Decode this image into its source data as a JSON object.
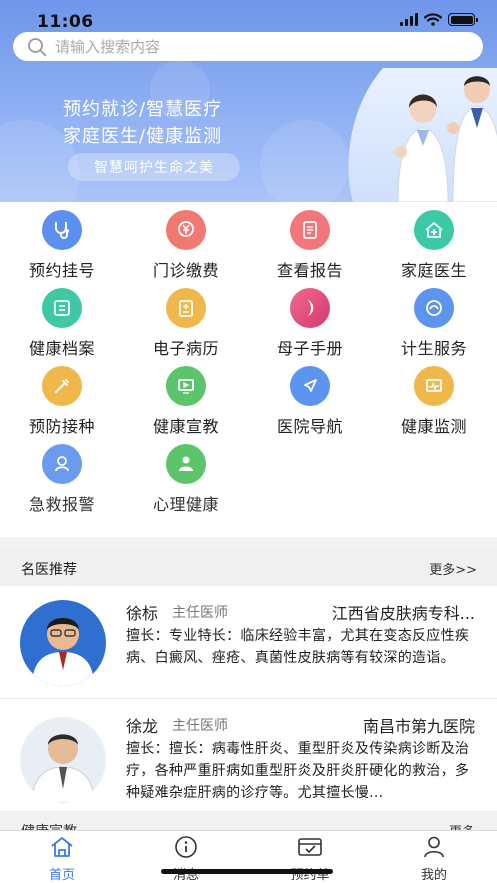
{
  "status_bar": {
    "time": "11:06"
  },
  "search": {
    "placeholder": "请输入搜索内容"
  },
  "banner": {
    "line1": "预约就诊/智慧医疗",
    "line2": "家庭医生/健康监测",
    "pill": "智慧呵护生命之美"
  },
  "services": [
    {
      "label": "预约挂号",
      "icon": "stethoscope-icon",
      "color": "#5b8ff0"
    },
    {
      "label": "门诊缴费",
      "icon": "yuan-payment-icon",
      "color": "#f07a72"
    },
    {
      "label": "查看报告",
      "icon": "report-icon",
      "color": "#f2767a"
    },
    {
      "label": "家庭医生",
      "icon": "home-medical-icon",
      "color": "#3cc9a5"
    },
    {
      "label": "健康档案",
      "icon": "health-file-icon",
      "color": "#3fc8a6"
    },
    {
      "label": "电子病历",
      "icon": "medical-record-icon",
      "color": "#f0b84a"
    },
    {
      "label": "母子手册",
      "icon": "mother-child-icon",
      "color": "#e2467a"
    },
    {
      "label": "计生服务",
      "icon": "family-planning-icon",
      "color": "#5c95ef"
    },
    {
      "label": "预防接种",
      "icon": "vaccine-icon",
      "color": "#f0b84a"
    },
    {
      "label": "健康宣教",
      "icon": "health-education-icon",
      "color": "#5cc46a"
    },
    {
      "label": "医院导航",
      "icon": "navigation-icon",
      "color": "#5c95ef"
    },
    {
      "label": "健康监测",
      "icon": "monitor-icon",
      "color": "#f0b84a"
    },
    {
      "label": "急救报警",
      "icon": "emergency-icon",
      "color": "#6a9bef"
    },
    {
      "label": "心理健康",
      "icon": "psychology-icon",
      "color": "#5cc46a"
    }
  ],
  "doctors_section": {
    "title": "名医推荐",
    "more": "更多>>"
  },
  "doctors": [
    {
      "name": "徐标",
      "title": "主任医师",
      "hospital": "江西省皮肤病专科...",
      "description": "擅长：专业特长：临床经验丰富，尤其在变态反应性疾病、白癜风、痤疮、真菌性皮肤病等有较深的造诣。"
    },
    {
      "name": "徐龙",
      "title": "主任医师",
      "hospital": "南昌市第九医院",
      "description": "擅长：擅长：病毒性肝炎、重型肝炎及传染病诊断及治疗，各种严重肝病如重型肝炎及肝炎肝硬化的救治，多种疑难杂症肝病的诊疗等。尤其擅长慢..."
    }
  ],
  "next_section": {
    "title": "健康宣教",
    "more": "更多"
  },
  "tabbar": {
    "items": [
      {
        "label": "首页",
        "icon": "home-icon",
        "active": true
      },
      {
        "label": "消息",
        "icon": "info-icon",
        "active": false
      },
      {
        "label": "预约单",
        "icon": "appointment-icon",
        "active": false
      },
      {
        "label": "我的",
        "icon": "user-icon",
        "active": false
      }
    ]
  },
  "colors": {
    "accent": "#3d7be6",
    "banner": "#7a9ef0"
  }
}
